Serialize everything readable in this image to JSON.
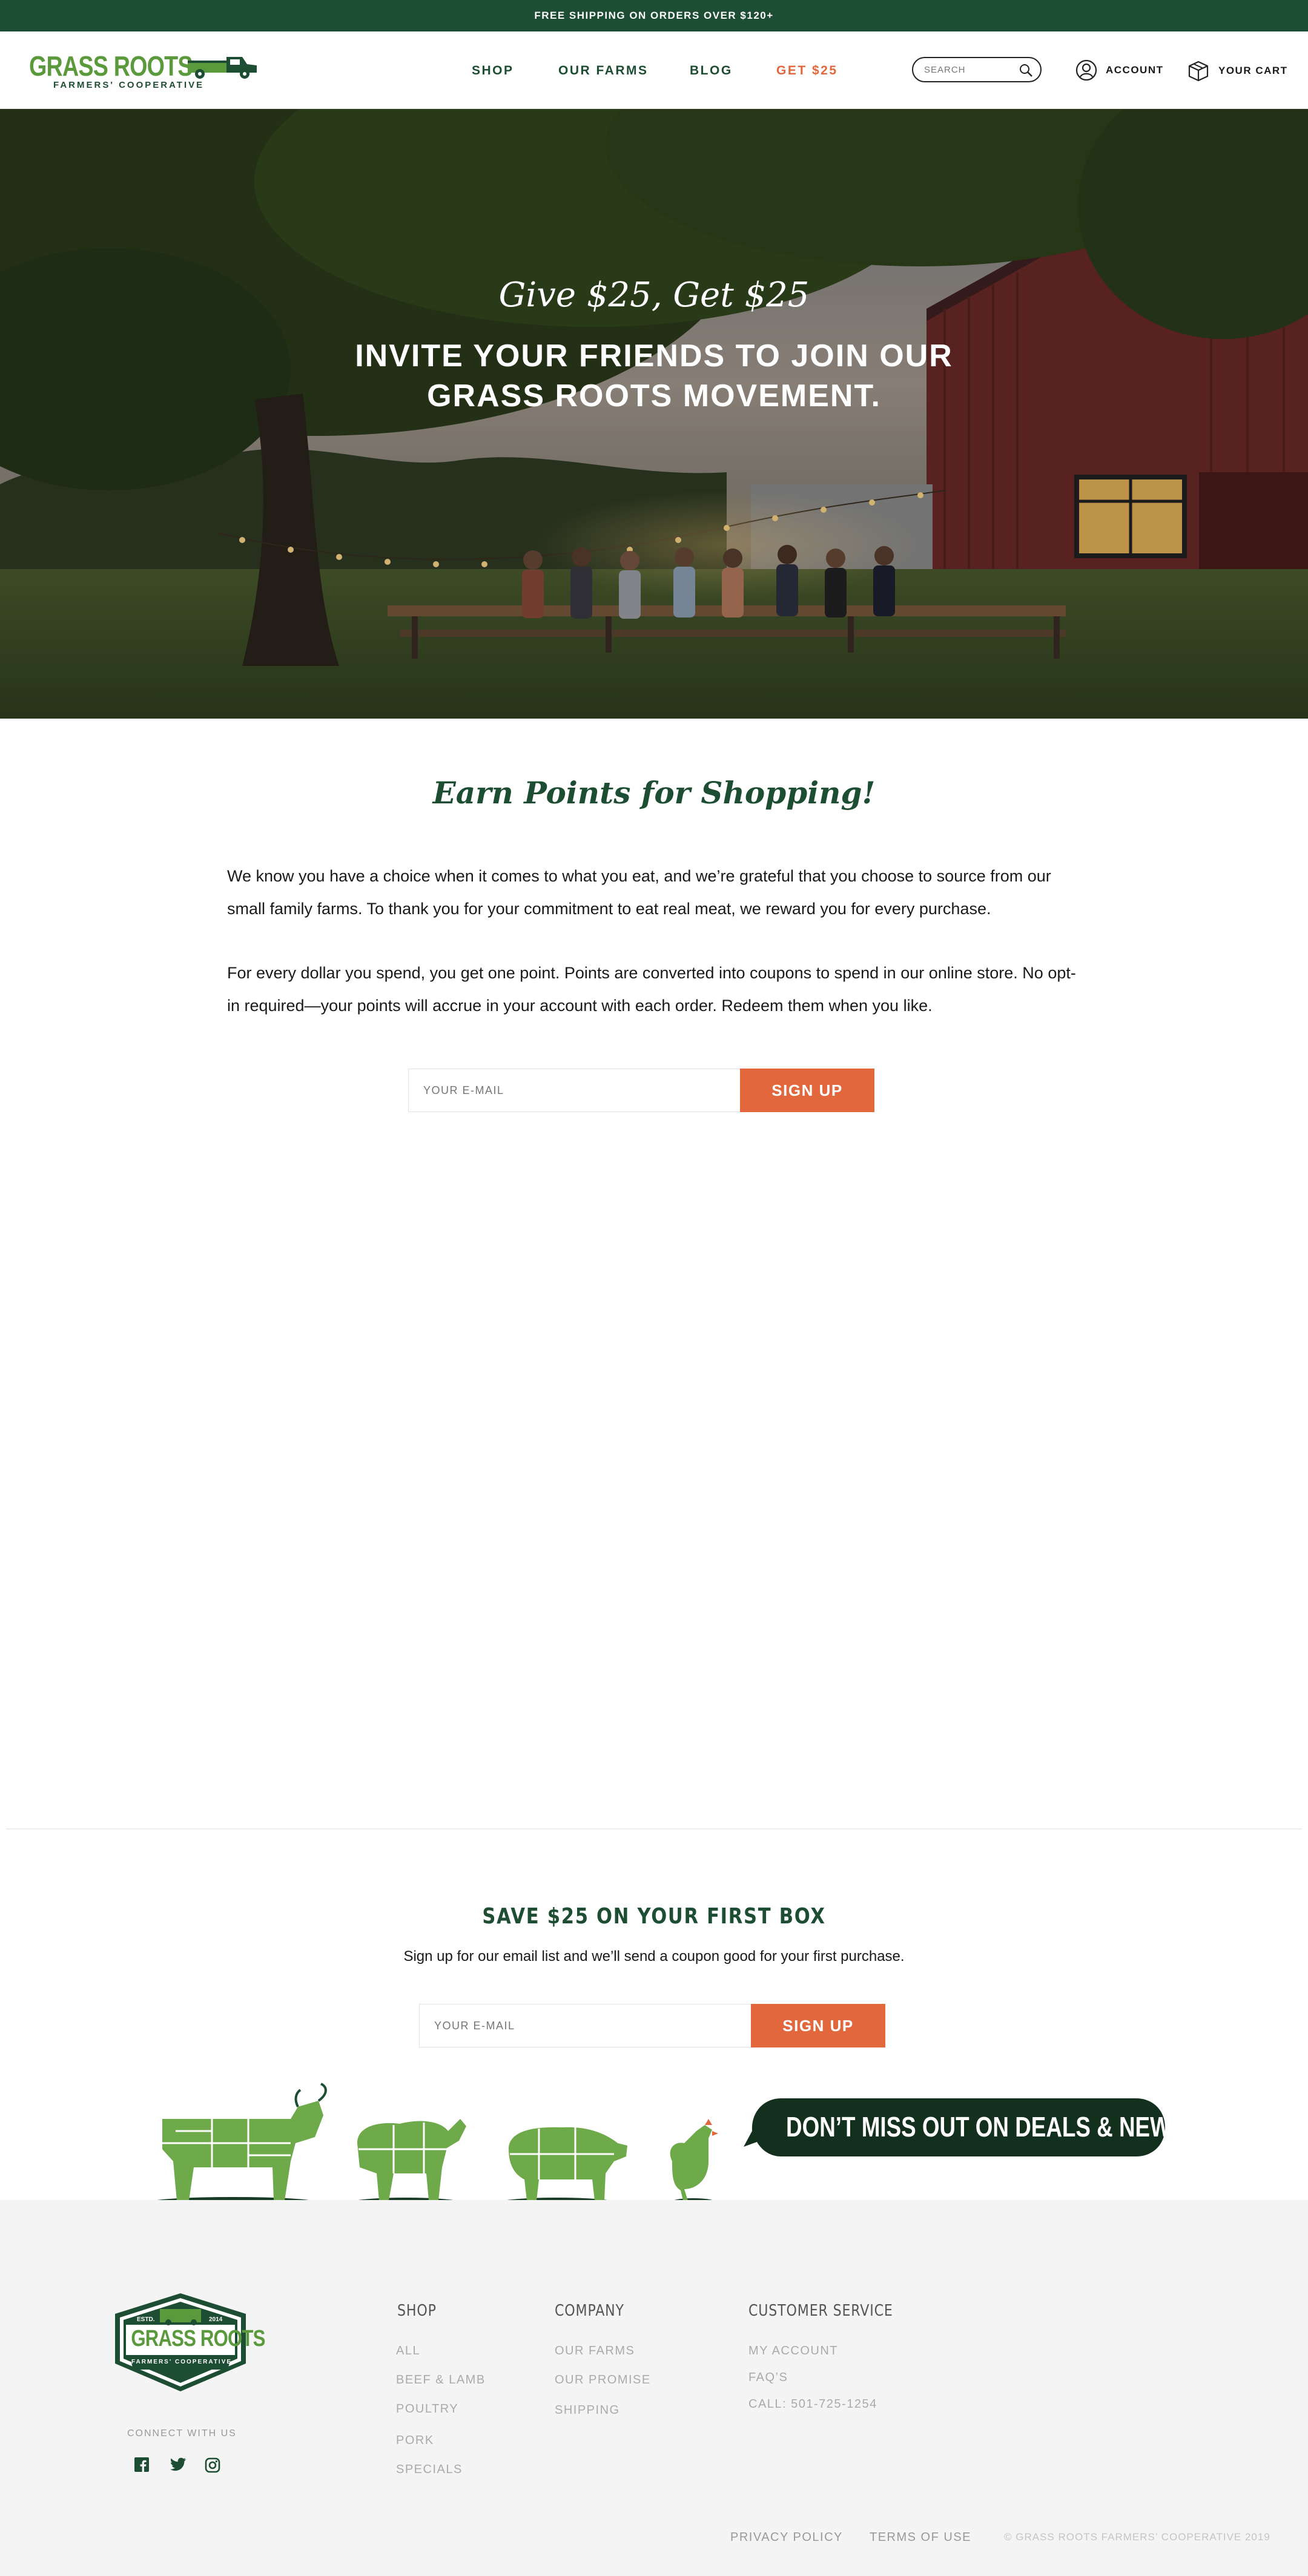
{
  "announcement": {
    "text": "FREE SHIPPING ON ORDERS OVER $120+"
  },
  "brand": {
    "name": "GRASS ROOTS",
    "subtitle": "FARMERS' COOPERATIVE",
    "estd_left": "ESTD.",
    "estd_right": "2014"
  },
  "nav": {
    "items": [
      {
        "label": "SHOP"
      },
      {
        "label": "OUR FARMS"
      },
      {
        "label": "BLOG"
      },
      {
        "label": "GET $25"
      }
    ]
  },
  "search": {
    "placeholder": "SEARCH"
  },
  "header_links": {
    "account": "ACCOUNT",
    "cart": "YOUR CART"
  },
  "hero": {
    "tagline": "Give $25, Get $25",
    "headline": "INVITE YOUR FRIENDS TO JOIN OUR GRASS ROOTS MOVEMENT."
  },
  "points": {
    "title": "Earn Points for Shopping!",
    "paragraph1": "We know you have a choice when it comes to what you eat, and we’re grateful that you choose to source from our small family farms. To thank you for your commitment to eat real meat, we reward you for every purchase.",
    "paragraph2": "For every dollar you spend, you get one point. Points are converted into coupons to spend in our online store. No opt-in required—your points will accrue in your account with each order. Redeem them when you like.",
    "email_placeholder": "YOUR E-MAIL",
    "button": "SIGN UP"
  },
  "newsletter": {
    "title": "SAVE $25 ON YOUR FIRST BOX",
    "subtitle": "Sign up for our email list and we’ll send a coupon good for your first purchase.",
    "email_placeholder": "YOUR E-MAIL",
    "button": "SIGN UP",
    "bubble": "DON’T MISS OUT ON DEALS & NEWS!"
  },
  "footer": {
    "connect": "CONNECT WITH US",
    "social": [
      "facebook-icon",
      "twitter-icon",
      "instagram-icon"
    ],
    "shop": {
      "title": "SHOP",
      "links": [
        "ALL",
        "BEEF & LAMB",
        "POULTRY",
        "PORK",
        "SPECIALS"
      ]
    },
    "company": {
      "title": "COMPANY",
      "links": [
        "OUR FARMS",
        "OUR PROMISE",
        "SHIPPING"
      ]
    },
    "customer_service": {
      "title": "CUSTOMER SERVICE",
      "links": [
        "MY ACCOUNT",
        "FAQ’S",
        "CALL: 501-725-1254"
      ]
    },
    "legal": [
      "PRIVACY POLICY",
      "TERMS OF USE"
    ],
    "copyright": "© GRASS ROOTS FARMERS’ COOPERATIVE 2019"
  },
  "colors": {
    "brand_dark_green": "#1d4d32",
    "brand_light_green": "#5b9a3c",
    "accent_orange": "#e2673c",
    "footer_bg": "#f4f4f4"
  }
}
